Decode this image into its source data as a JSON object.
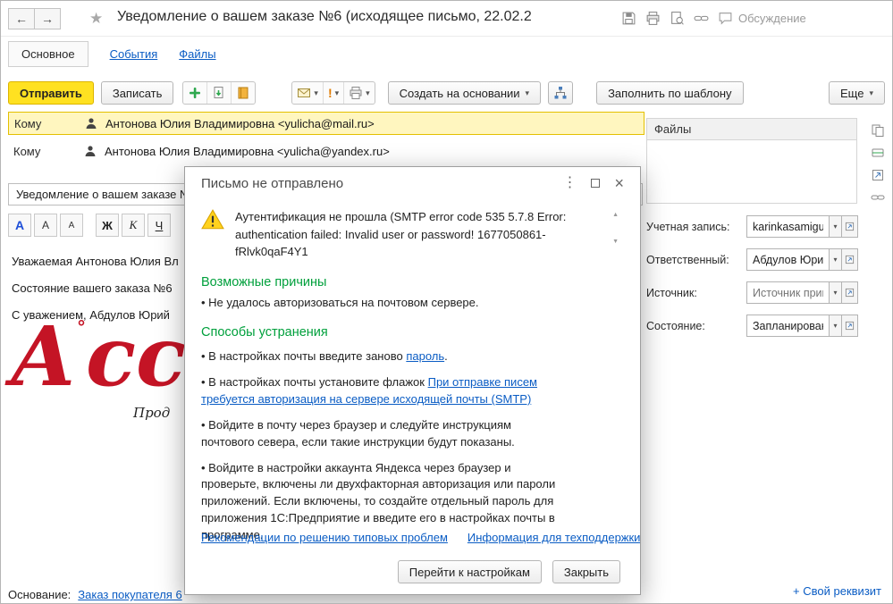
{
  "icons": {
    "back": "←",
    "forward": "→",
    "star": "★",
    "dots": "⋮",
    "close": "×",
    "dropdown": "▾",
    "scroll_up": "▲",
    "scroll_down": "▼",
    "exclamation": "!"
  },
  "titlebar": {
    "title": "Уведомление о вашем заказе №6 (исходящее письмо, 22.02.2",
    "discussion": "Обсуждение"
  },
  "tabs": [
    {
      "label": "Основное"
    },
    {
      "label": "События"
    },
    {
      "label": "Файлы"
    }
  ],
  "toolbar": {
    "send": "Отправить",
    "save": "Записать",
    "create_on_basis": "Создать на основании",
    "fill_by_template": "Заполнить по шаблону",
    "more": "Еще"
  },
  "format_toolbar": {
    "font_color": "A",
    "font_increase": "A",
    "font_decrease": "A",
    "bold": "Ж",
    "italic": "К",
    "underline": "Ч"
  },
  "message": {
    "to_label": "Кому",
    "recipients": [
      {
        "text": "Антонова Юлия Владимировна <yulicha@mail.ru>"
      },
      {
        "text": "Антонова Юлия Владимировна <yulicha@yandex.ru>"
      }
    ],
    "subject": "Уведомление о вашем заказе №",
    "body": {
      "line1": "Уважаемая Антонова Юлия Вл",
      "line2": "Состояние вашего заказа №6",
      "line3": "С уважением, Абдулов Юрий",
      "logo_first": "А",
      "logo_reg": "°",
      "logo_rest": "ссо",
      "logo_caption": "Прод"
    }
  },
  "files_panel": {
    "header": "Файлы"
  },
  "details": {
    "fields": [
      {
        "label": "Учетная запись:",
        "value": "karinkasamigu"
      },
      {
        "label": "Ответственный:",
        "value": "Абдулов Юрий"
      },
      {
        "label": "Источник:",
        "value": "Источник прив"
      },
      {
        "label": "Состояние:",
        "value": "Запланирован"
      }
    ]
  },
  "footer": {
    "basis_label": "Основание:",
    "basis_link": "Заказ покупателя 6",
    "custom_attribute": "+ Свой реквизит"
  },
  "dialog": {
    "title": "Письмо не отправлено",
    "error": "Аутентификация не прошла (SMTP error code 535 5.7.8 Error: authentication failed: Invalid user or password! 1677050861-fRlvk0qaF4Y1",
    "causes_heading": "Возможные причины",
    "cause1": "• Не удалось авторизоваться на почтовом сервере.",
    "solutions_heading": "Способы устранения",
    "sol1_text": "• В настройках почты введите заново ",
    "sol1_link": "пароль",
    "sol1_end": ".",
    "sol2_text": "• В настройках почты установите флажок ",
    "sol2_link": "При отправке писем требуется авторизация на сервере исходящей почты (SMTP)",
    "sol3": "• Войдите в почту через браузер и следуйте инструкциям почтового севера, если такие инструкции будут показаны.",
    "sol4": "• Войдите в настройки аккаунта Яндекса через браузер и проверьте, включены ли двухфакторная авторизация или пароли приложений. Если включены, то создайте отдельный пароль для приложения 1С:Предприятие и введите его в настройках почты в программе.",
    "link_recommendations": "Рекомендации по решению типовых проблем",
    "link_support": "Информация для техподдержки",
    "btn_settings": "Перейти к настройкам",
    "btn_close": "Закрыть"
  },
  "colors": {
    "accent_yellow": "#ffe121",
    "focus_fill": "#fff6bf",
    "link_blue": "#0a5cc4",
    "green_heading": "#00a03c",
    "logo_red": "#c41425"
  }
}
